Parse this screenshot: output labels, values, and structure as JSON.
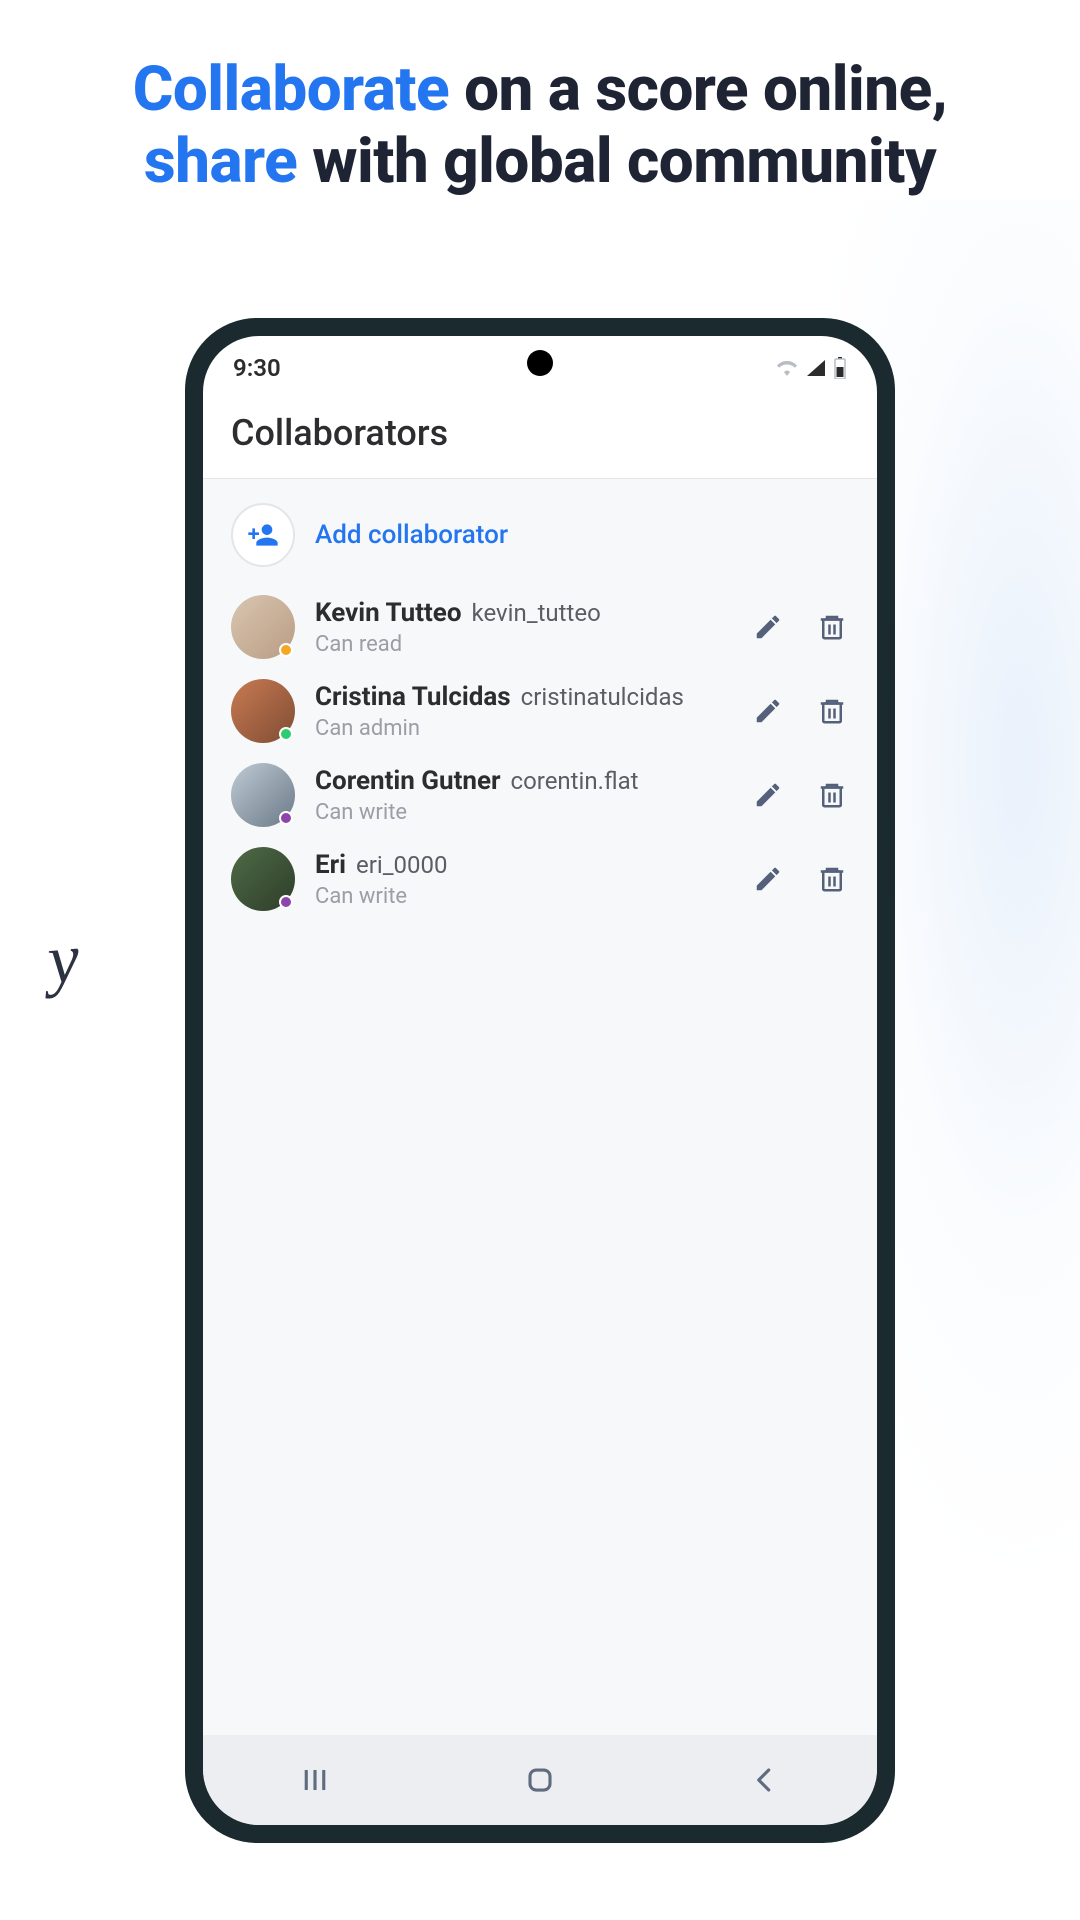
{
  "heading": {
    "w1": "Collaborate",
    "w2": " on a score online, ",
    "w3": "share",
    "w4": " with global community"
  },
  "statusbar": {
    "time": "9:30"
  },
  "page_title": "Collaborators",
  "add_label": "Add collaborator",
  "colors": {
    "accent": "#2476f0",
    "status_orange": "#f5a623",
    "status_green": "#2ecc71",
    "status_purple": "#8e44ad"
  },
  "collaborators": [
    {
      "name": "Kevin Tutteo",
      "username": "kevin_tutteo",
      "permission": "Can read",
      "status_color": "#f5a623",
      "avatar_bg": "linear-gradient(135deg,#d9c6b0,#b99c84)"
    },
    {
      "name": "Cristina Tulcidas",
      "username": "cristinatulcidas",
      "permission": "Can admin",
      "status_color": "#2ecc71",
      "avatar_bg": "linear-gradient(135deg,#c97a52,#7f4d34)"
    },
    {
      "name": "Corentin Gutner",
      "username": "corentin.flat",
      "permission": "Can write",
      "status_color": "#8e44ad",
      "avatar_bg": "linear-gradient(135deg,#bfcad4,#6b7a88)"
    },
    {
      "name": "Eri",
      "username": "eri_0000",
      "permission": "Can write",
      "status_color": "#8e44ad",
      "avatar_bg": "linear-gradient(135deg,#4e6b46,#2e3d2a)"
    }
  ]
}
